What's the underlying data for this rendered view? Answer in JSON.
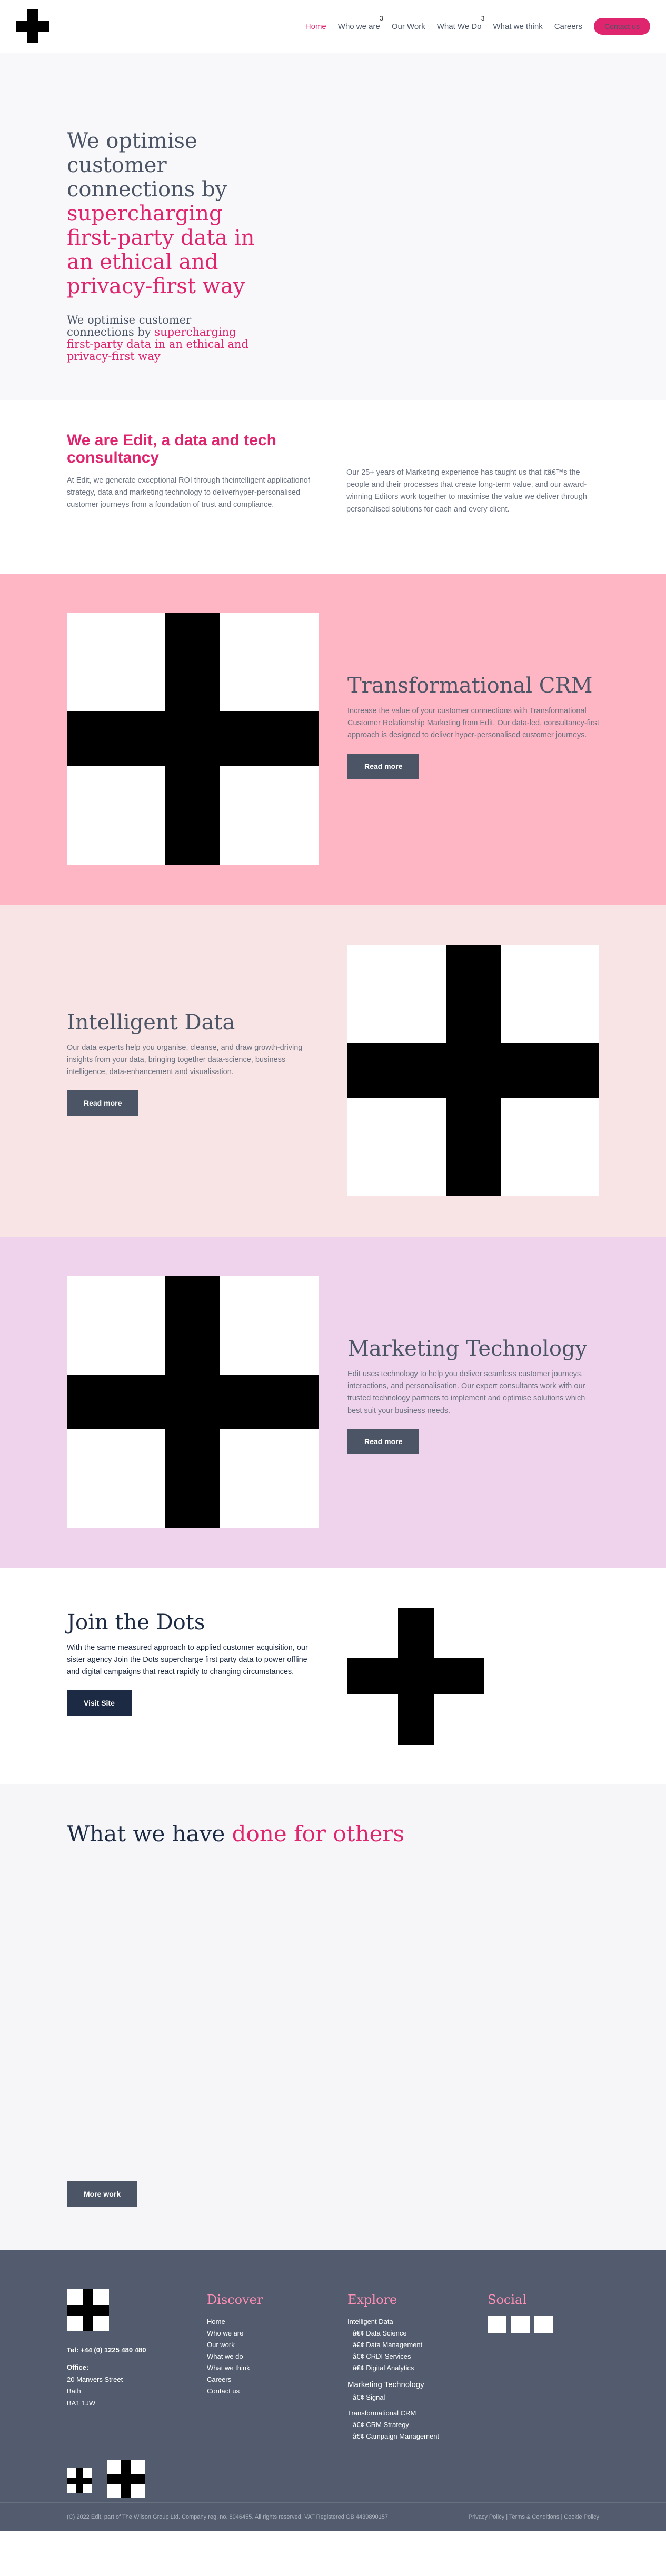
{
  "nav": {
    "items": [
      {
        "label": "Home",
        "active": true,
        "sup": ""
      },
      {
        "label": "Who we are",
        "active": false,
        "sup": "3"
      },
      {
        "label": "Our Work",
        "active": false,
        "sup": ""
      },
      {
        "label": "What We Do",
        "active": false,
        "sup": "3"
      },
      {
        "label": "What we think",
        "active": false,
        "sup": ""
      },
      {
        "label": "Careers",
        "active": false,
        "sup": ""
      }
    ],
    "contact_label": "Contact us"
  },
  "hero": {
    "title_plain": "We optimise customer connections by ",
    "title_accent": "supercharging first-party data in an ethical and privacy-first way",
    "sub_plain": "We optimise customer connections by ",
    "sub_accent": "supercharging first-party data in an ethical and privacy-first way"
  },
  "intro": {
    "heading": "We are Edit, a data and tech consultancy",
    "left": "At Edit, we generate exceptional ROI through theintelligent applicationof strategy, data and marketing technology to deliverhyper-personalised customer journeys from a foundation of trust and compliance.",
    "right": "Our 25+ years of Marketing experience has taught us that itâ€™s the people and their processes that create long-term value, and our award-winning Editors work together to maximise the value we deliver through personalised solutions for each and every client."
  },
  "bands": [
    {
      "title": "Transformational CRM",
      "text": "Increase the value of your customer connections with Transformational Customer Relationship Marketing from Edit. Our data-led, consultancy-first approach is designed to deliver hyper-personalised customer journeys.",
      "button": "Read more"
    },
    {
      "title": "Intelligent Data",
      "text": "Our data experts help you organise, cleanse, and draw growth-driving insights from your data, bringing together data-science, business intelligence, data-enhancement and visualisation.",
      "button": "Read more"
    },
    {
      "title": "Marketing Technology",
      "text": "Edit uses technology to help you deliver seamless customer journeys, interactions, and personalisation. Our expert consultants work with our trusted technology partners to implement and optimise solutions which best suit your business needs.",
      "button": "Read more"
    }
  ],
  "dots": {
    "title": "Join the Dots",
    "text": "With the same measured approach to applied customer acquisition, our sister agency Join the Dots supercharge first party data to power offline and digital campaigns that react rapidly to changing circumstances.",
    "button": "Visit Site"
  },
  "work": {
    "title_plain": "What we have ",
    "title_accent": "done for others",
    "button": "More work"
  },
  "footer": {
    "tel": "Tel: +44 (0) 1225 480 480",
    "office_label": "Office:",
    "address": [
      "20 Manvers Street",
      "Bath",
      "BA1 1JW"
    ],
    "discover": {
      "title": "Discover",
      "items": [
        "Home",
        "Who we are",
        "Our work",
        "What we do",
        "What we think",
        "Careers",
        "Contact us"
      ]
    },
    "explore": {
      "title": "Explore",
      "group1": "Intelligent Data",
      "group1_items": [
        "â€¢ Data Science",
        "â€¢ Data Management",
        "â€¢ CRDI Services",
        "â€¢ Digital Analytics"
      ],
      "group2": "Marketing Technology",
      "group2_items": [
        "â€¢ Signal"
      ],
      "group3": "Transformational CRM",
      "group3_items": [
        "â€¢ CRM Strategy",
        "â€¢ Campaign Management"
      ]
    },
    "social_title": "Social",
    "social_icons": [
      "linkedin-icon",
      "twitter-icon",
      "instagram-icon"
    ],
    "copyright": "(C) 2022 Edit, part of The Wilson Group Ltd. Company reg. no. 8046455. All rights reserved. VAT Registered GB 4439890157",
    "legal": "Privacy Policy | Terms & Conditions | Cookie Policy"
  }
}
